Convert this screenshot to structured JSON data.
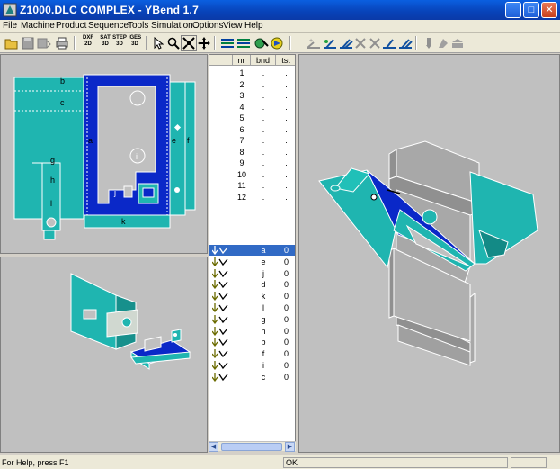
{
  "window": {
    "title": "Z1000.DLC COMPLEX - YBend 1.7"
  },
  "menu": [
    {
      "id": "file",
      "label": "File"
    },
    {
      "id": "machine",
      "label": "Machine"
    },
    {
      "id": "product",
      "label": "Product"
    },
    {
      "id": "sequence",
      "label": "Sequence"
    },
    {
      "id": "tools",
      "label": "Tools"
    },
    {
      "id": "simulation",
      "label": "Simulation"
    },
    {
      "id": "options",
      "label": "Options"
    },
    {
      "id": "view",
      "label": "View"
    },
    {
      "id": "help",
      "label": "Help"
    }
  ],
  "toolbar": {
    "dxf": "DXF\n2D",
    "sat": "SAT\n3D",
    "step": "STEP\n3D",
    "iges": "IGES\n3D"
  },
  "list": {
    "headers": [
      "nr",
      "bnd",
      "tst"
    ],
    "numbered_rows": [
      {
        "nr": "1",
        "bnd": ".",
        "tst": "."
      },
      {
        "nr": "2",
        "bnd": ".",
        "tst": "."
      },
      {
        "nr": "3",
        "bnd": ".",
        "tst": "."
      },
      {
        "nr": "4",
        "bnd": ".",
        "tst": "."
      },
      {
        "nr": "5",
        "bnd": ".",
        "tst": "."
      },
      {
        "nr": "6",
        "bnd": ".",
        "tst": "."
      },
      {
        "nr": "7",
        "bnd": ".",
        "tst": "."
      },
      {
        "nr": "8",
        "bnd": ".",
        "tst": "."
      },
      {
        "nr": "9",
        "bnd": ".",
        "tst": "."
      },
      {
        "nr": "10",
        "bnd": ".",
        "tst": "."
      },
      {
        "nr": "11",
        "bnd": ".",
        "tst": "."
      },
      {
        "nr": "12",
        "bnd": ".",
        "tst": "."
      }
    ],
    "bend_rows": [
      {
        "bnd": "a",
        "tst": "0",
        "selected": true
      },
      {
        "bnd": "e",
        "tst": "0",
        "selected": false
      },
      {
        "bnd": "j",
        "tst": "0",
        "selected": false
      },
      {
        "bnd": "d",
        "tst": "0",
        "selected": false
      },
      {
        "bnd": "k",
        "tst": "0",
        "selected": false
      },
      {
        "bnd": "l",
        "tst": "0",
        "selected": false
      },
      {
        "bnd": "g",
        "tst": "0",
        "selected": false
      },
      {
        "bnd": "h",
        "tst": "0",
        "selected": false
      },
      {
        "bnd": "b",
        "tst": "0",
        "selected": false
      },
      {
        "bnd": "f",
        "tst": "0",
        "selected": false
      },
      {
        "bnd": "i",
        "tst": "0",
        "selected": false
      },
      {
        "bnd": "c",
        "tst": "0",
        "selected": false
      }
    ]
  },
  "flat_view": {
    "labels": [
      {
        "t": "b"
      },
      {
        "t": "c"
      },
      {
        "t": "a"
      },
      {
        "t": "e"
      },
      {
        "t": "f"
      },
      {
        "t": "g"
      },
      {
        "t": "h"
      },
      {
        "t": "i"
      },
      {
        "t": "j"
      },
      {
        "t": "l"
      },
      {
        "t": "k"
      }
    ]
  },
  "status": {
    "help": "For Help, press F1",
    "state": "OK"
  },
  "colors": {
    "part": "#1fb5b0",
    "bend": "#0a28c8",
    "selection": "#316ac5",
    "background": "#c0c0c0"
  }
}
